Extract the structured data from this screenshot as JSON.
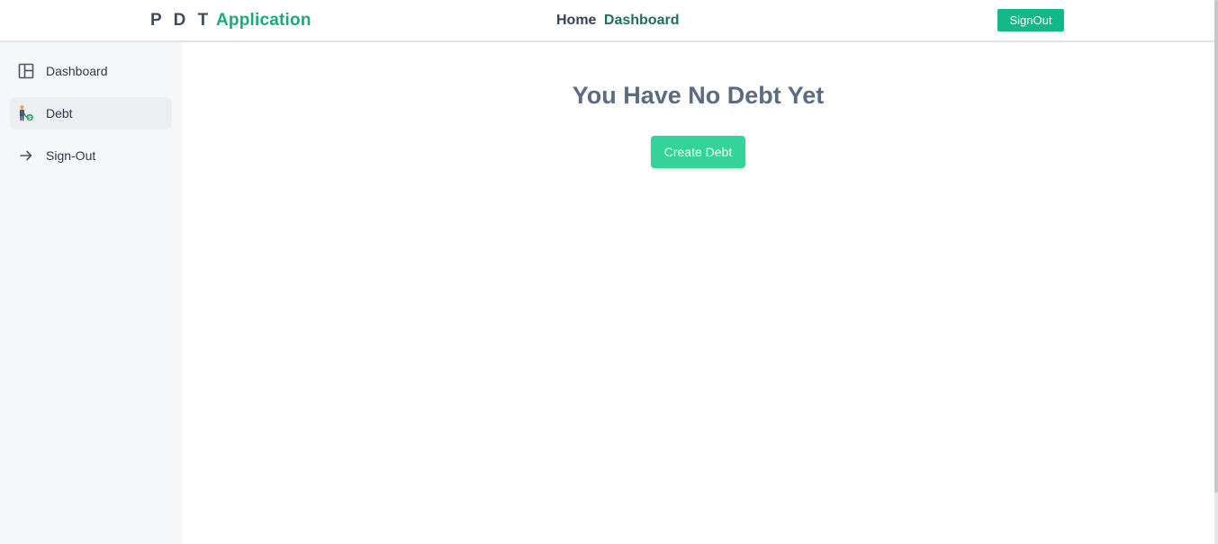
{
  "navbar": {
    "brand_prefix": "P D T",
    "brand_suffix": "Application",
    "links": {
      "home": "Home",
      "dashboard": "Dashboard"
    },
    "signout_label": "SignOut"
  },
  "sidebar": {
    "items": [
      {
        "label": "Dashboard",
        "icon": "layout-icon",
        "active": false
      },
      {
        "label": "Debt",
        "icon": "debt-person-icon",
        "active": true
      },
      {
        "label": "Sign-Out",
        "icon": "arrow-right-icon",
        "active": false
      }
    ]
  },
  "main": {
    "heading": "You Have No Debt Yet",
    "create_label": "Create Debt"
  },
  "colors": {
    "brand_green": "#1aaa7a",
    "signout_bg": "#12b886",
    "create_bg": "#34d399",
    "heading": "#5b6b80"
  }
}
